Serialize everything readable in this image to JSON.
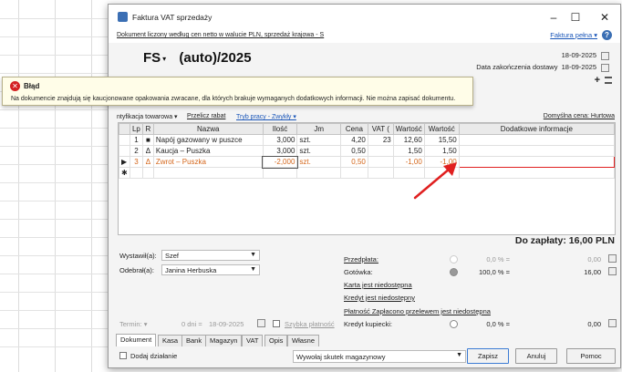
{
  "window": {
    "title": "Faktura VAT sprzedaży",
    "description": "Dokument liczony według cen netto w walucie PLN, sprzedaż krajowa - S",
    "full_link": "Faktura pełna ▾",
    "help": "?",
    "minimize": "–",
    "maximize": "☐",
    "close": "✕"
  },
  "doc": {
    "series": "FS",
    "number": "(auto)/2025",
    "date": "18-09-2025",
    "delivery_label": "Data zakończenia dostawy",
    "delivery_date": "18-09-2025"
  },
  "error": {
    "title": "Błąd",
    "message": "Na dokumencie znajdują się kaucjonowane opakowania zwracane, dla których brakuje wymaganych dodatkowych informacji. Nie można zapisać dokumentu."
  },
  "toolbar": {
    "ident": "ntyfikacja towarowa ▾",
    "recalc": "Przelicz rabat",
    "mode": "Tryb pracy - Zwykły ▾",
    "price": "Domyślna cena: Hurtowa"
  },
  "table": {
    "headers": [
      "Lp",
      "R",
      "Nazwa",
      "Ilość",
      "Jm",
      "Cena",
      "VAT (",
      "Wartość",
      "Wartość",
      "Dodatkowe informacje"
    ],
    "rows": [
      {
        "lp": "1",
        "r": "■",
        "name": "Napój gazowany w puszce",
        "qty": "3,000",
        "jm": "szt.",
        "price": "4,20",
        "vat": "23",
        "net": "12,60",
        "gross": "15,50",
        "info": ""
      },
      {
        "lp": "2",
        "r": "Δ",
        "name": "Kaucja – Puszka",
        "qty": "3,000",
        "jm": "szt.",
        "price": "0,50",
        "vat": "",
        "net": "1,50",
        "gross": "1,50",
        "info": ""
      },
      {
        "lp": "3",
        "r": "Δ",
        "name": "Zwrot – Puszka",
        "qty": "-2,000",
        "jm": "szt.",
        "price": "0,50",
        "vat": "",
        "net": "-1,00",
        "gross": "-1,00",
        "info": ""
      }
    ],
    "row_marker": "▶",
    "new_marker": "✱"
  },
  "total": "Do zapłaty: 16,00 PLN",
  "bottom": {
    "issued_label": "Wystawił(a):",
    "issued_value": "Szef",
    "received_label": "Odebrał(a):",
    "received_value": "Janina Herbuska",
    "term_label": "Termin:",
    "term_days": "0 dni =",
    "term_date": "18-09-2025",
    "quick_pay": "Szybka płatność"
  },
  "payments": {
    "prepay": "Przedpłata:",
    "prepay_pct": "0,0 % =",
    "prepay_val": "0,00",
    "cash": "Gotówka:",
    "cash_pct": "100,0 % =",
    "cash_val": "16,00",
    "card": "Karta jest niedostępna",
    "credit": "Kredyt jest niedostępny",
    "transfer": "Płatność Zapłacono przelewem jest niedostępna",
    "buyer_credit": "Kredyt kupiecki:",
    "bc_pct": "0,0 % =",
    "bc_val": "0,00"
  },
  "tabs": [
    "Dokument",
    "Kasa",
    "Bank",
    "Magazyn",
    "VAT",
    "Opis",
    "Własne"
  ],
  "footer": {
    "add_action": "Dodaj działanie",
    "warehouse": "Wywołaj skutek magazynowy",
    "save": "Zapisz",
    "cancel": "Anuluj",
    "help": "Pomoc"
  },
  "colors": {
    "error_red": "#e02020",
    "link": "#1a56b8",
    "return_row": "#d4661a"
  }
}
